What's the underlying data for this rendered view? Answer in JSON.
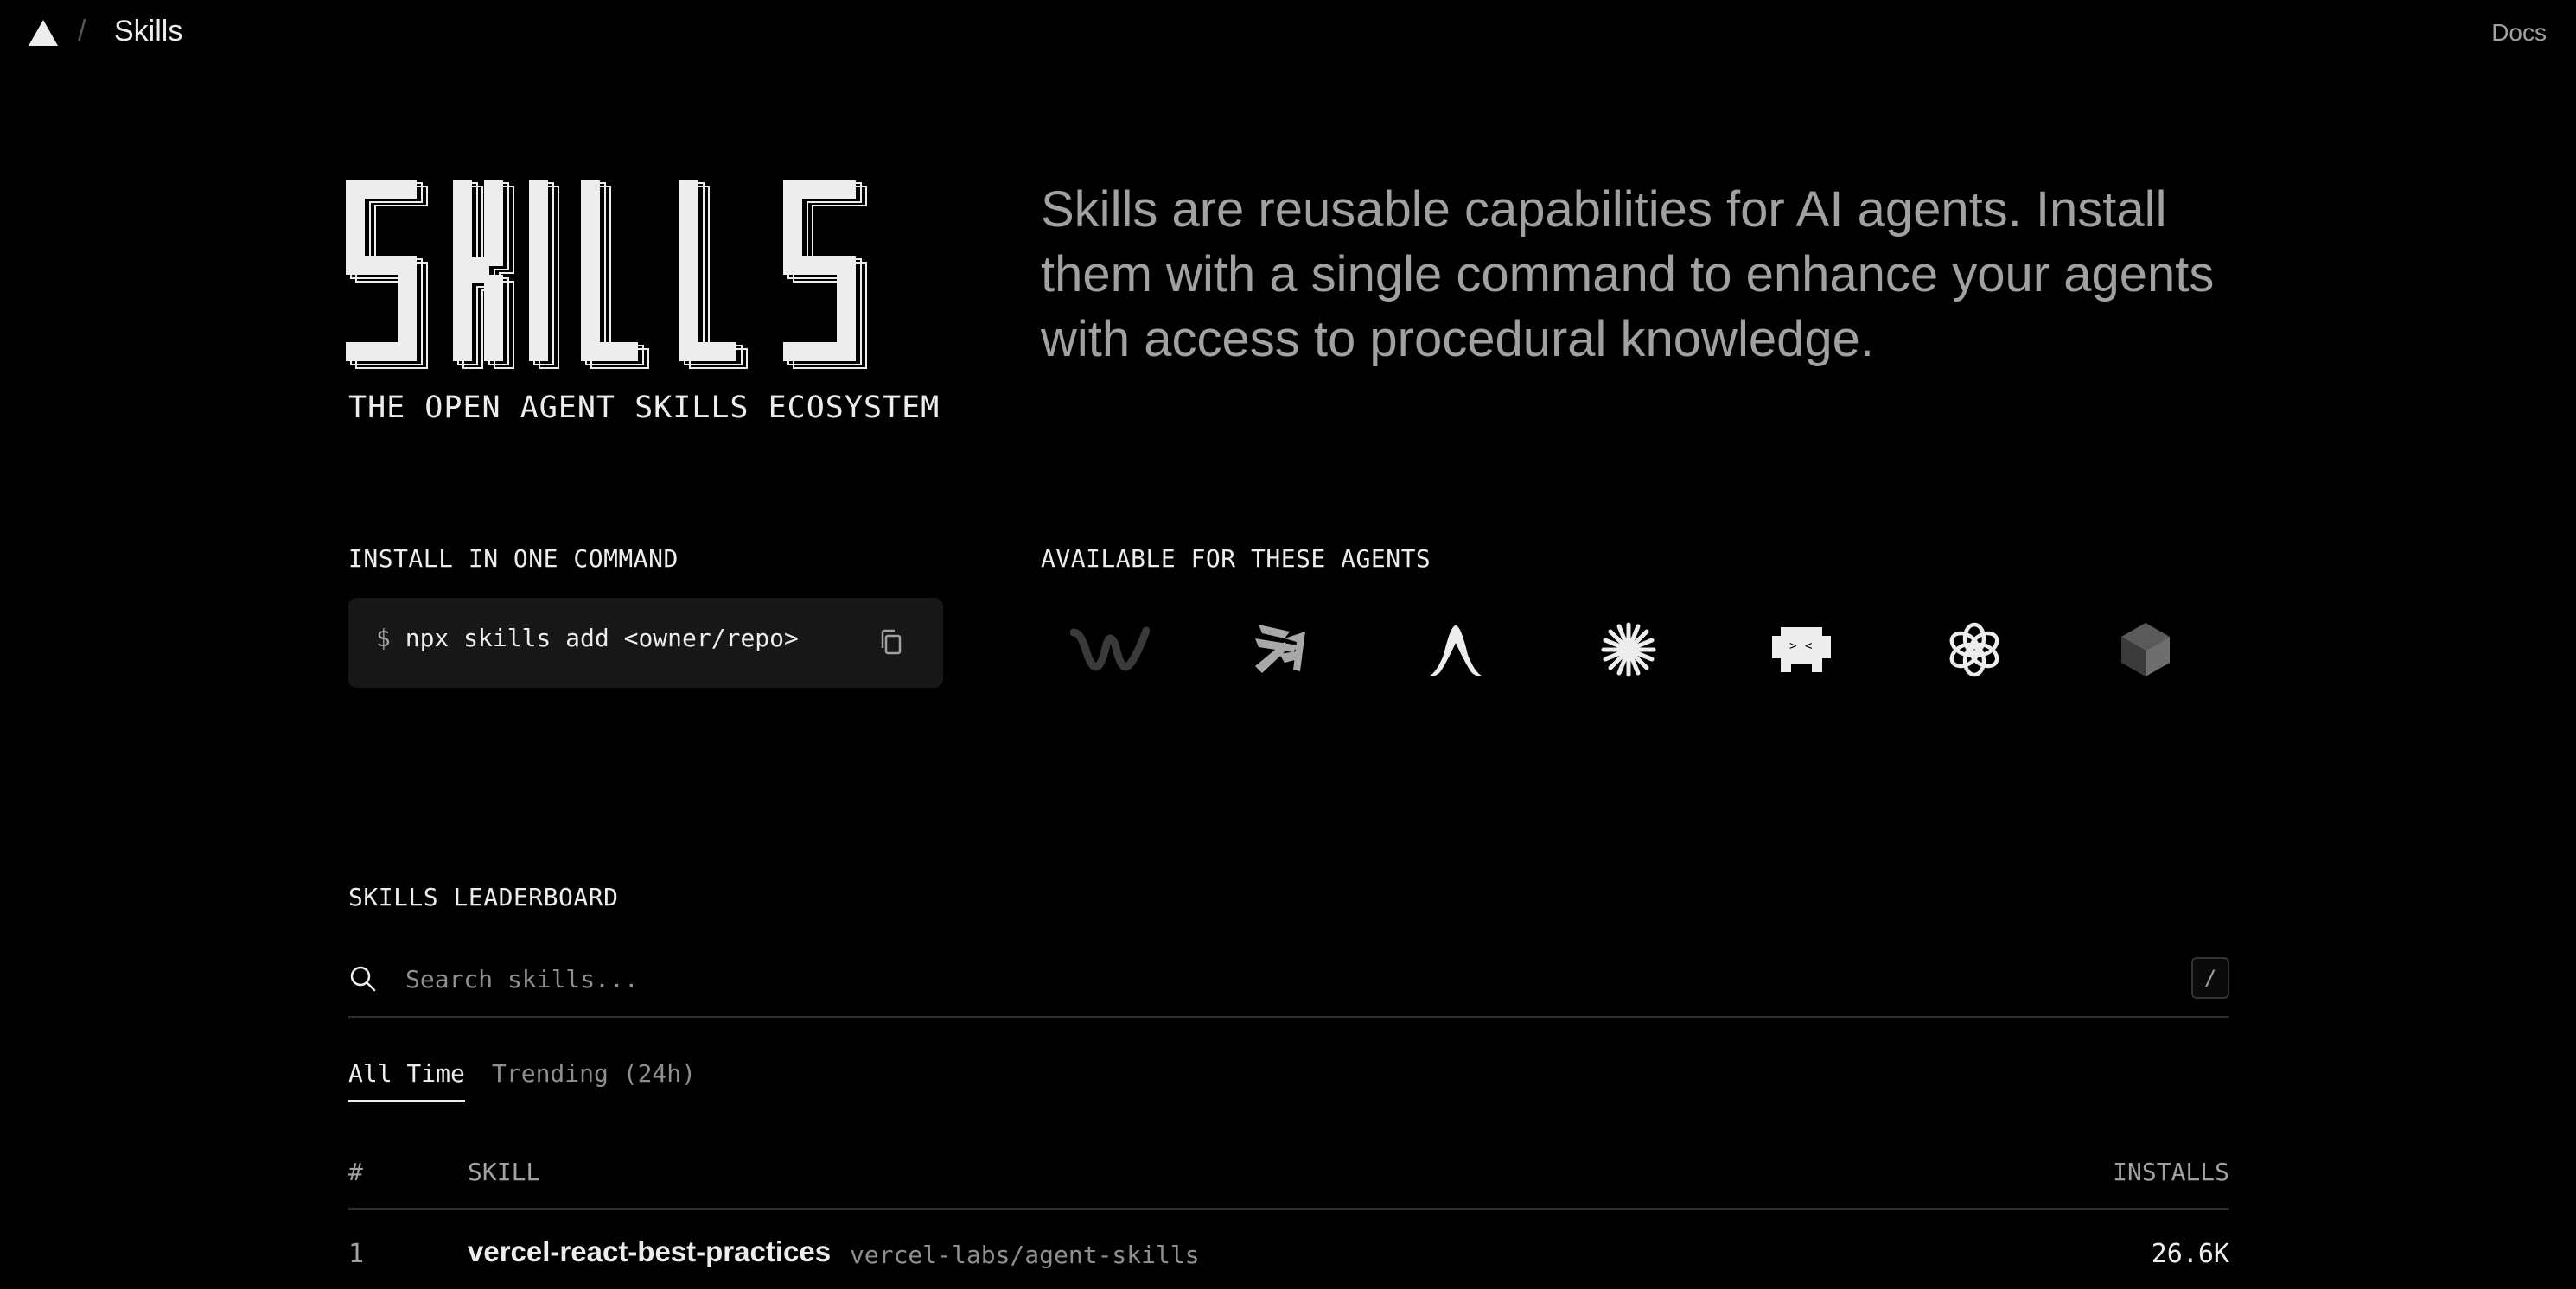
{
  "nav": {
    "slash": "/",
    "title": "Skills",
    "docs_label": "Docs",
    "logo_icon": "vercel-triangle-icon"
  },
  "hero": {
    "wordmark": "SKILLS",
    "tagline": "THE OPEN AGENT SKILLS ECOSYSTEM",
    "description": "Skills are reusable capabilities for AI agents. Install them with a single command to enhance your agents with access to procedural knowledge."
  },
  "install": {
    "label": "INSTALL IN ONE COMMAND",
    "prompt": "$",
    "command": "npx skills add <owner/repo>",
    "copy_icon": "copy-icon"
  },
  "agents": {
    "label": "AVAILABLE FOR THESE AGENTS",
    "icons": [
      "windsurf-icon",
      "amp-icon",
      "antigravity-icon",
      "claude-code-icon",
      "gemini-cli-icon",
      "openai-codex-icon",
      "cursor-icon"
    ]
  },
  "leaderboard": {
    "label": "SKILLS LEADERBOARD",
    "search_placeholder": "Search skills...",
    "search_shortcut": "/",
    "tabs": [
      {
        "label": "All Time",
        "active": true
      },
      {
        "label": "Trending (24h)",
        "active": false
      }
    ],
    "columns": {
      "rank": "#",
      "skill": "SKILL",
      "installs": "INSTALLS"
    },
    "rows": [
      {
        "rank": "1",
        "skill": "vercel-react-best-practices",
        "repo": "vercel-labs/agent-skills",
        "installs": "26.6K"
      }
    ]
  },
  "colors": {
    "background": "#000000",
    "text": "#ededed",
    "muted": "#a1a1a1",
    "command_bg": "#171717"
  }
}
